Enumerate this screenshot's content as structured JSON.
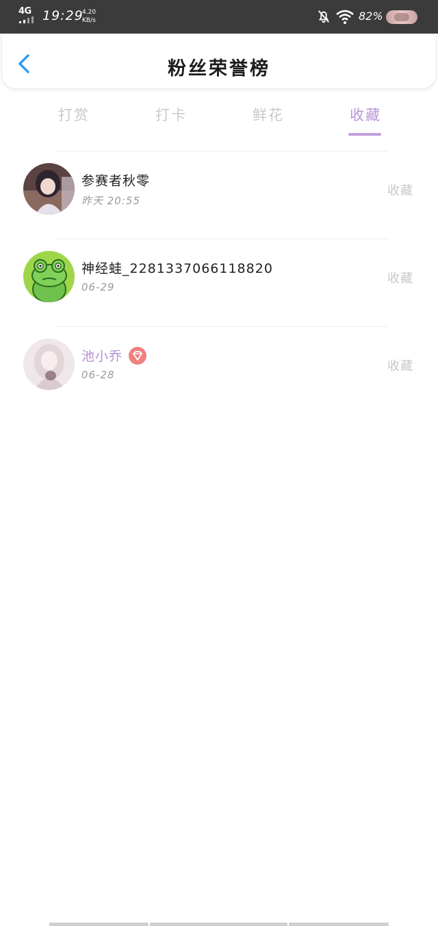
{
  "status_bar": {
    "network": "4G",
    "time": "19:29",
    "speed_value": "4.20",
    "speed_unit": "KB/s",
    "battery": "82%"
  },
  "header": {
    "title": "粉丝荣誉榜"
  },
  "tabs": [
    {
      "label": "打赏"
    },
    {
      "label": "打卡"
    },
    {
      "label": "鲜花"
    },
    {
      "label": "收藏"
    }
  ],
  "active_tab": "收藏",
  "accent_color": "#b994d6",
  "list": [
    {
      "name": "参赛者秋零",
      "date": "昨天 20:55",
      "action": "收藏"
    },
    {
      "name": "神经蛙_2281337066118820",
      "date": "06-29",
      "action": "收藏"
    },
    {
      "name": "池小乔",
      "date": "06-28",
      "action": "收藏",
      "badge_icon": "diamond-icon"
    }
  ]
}
